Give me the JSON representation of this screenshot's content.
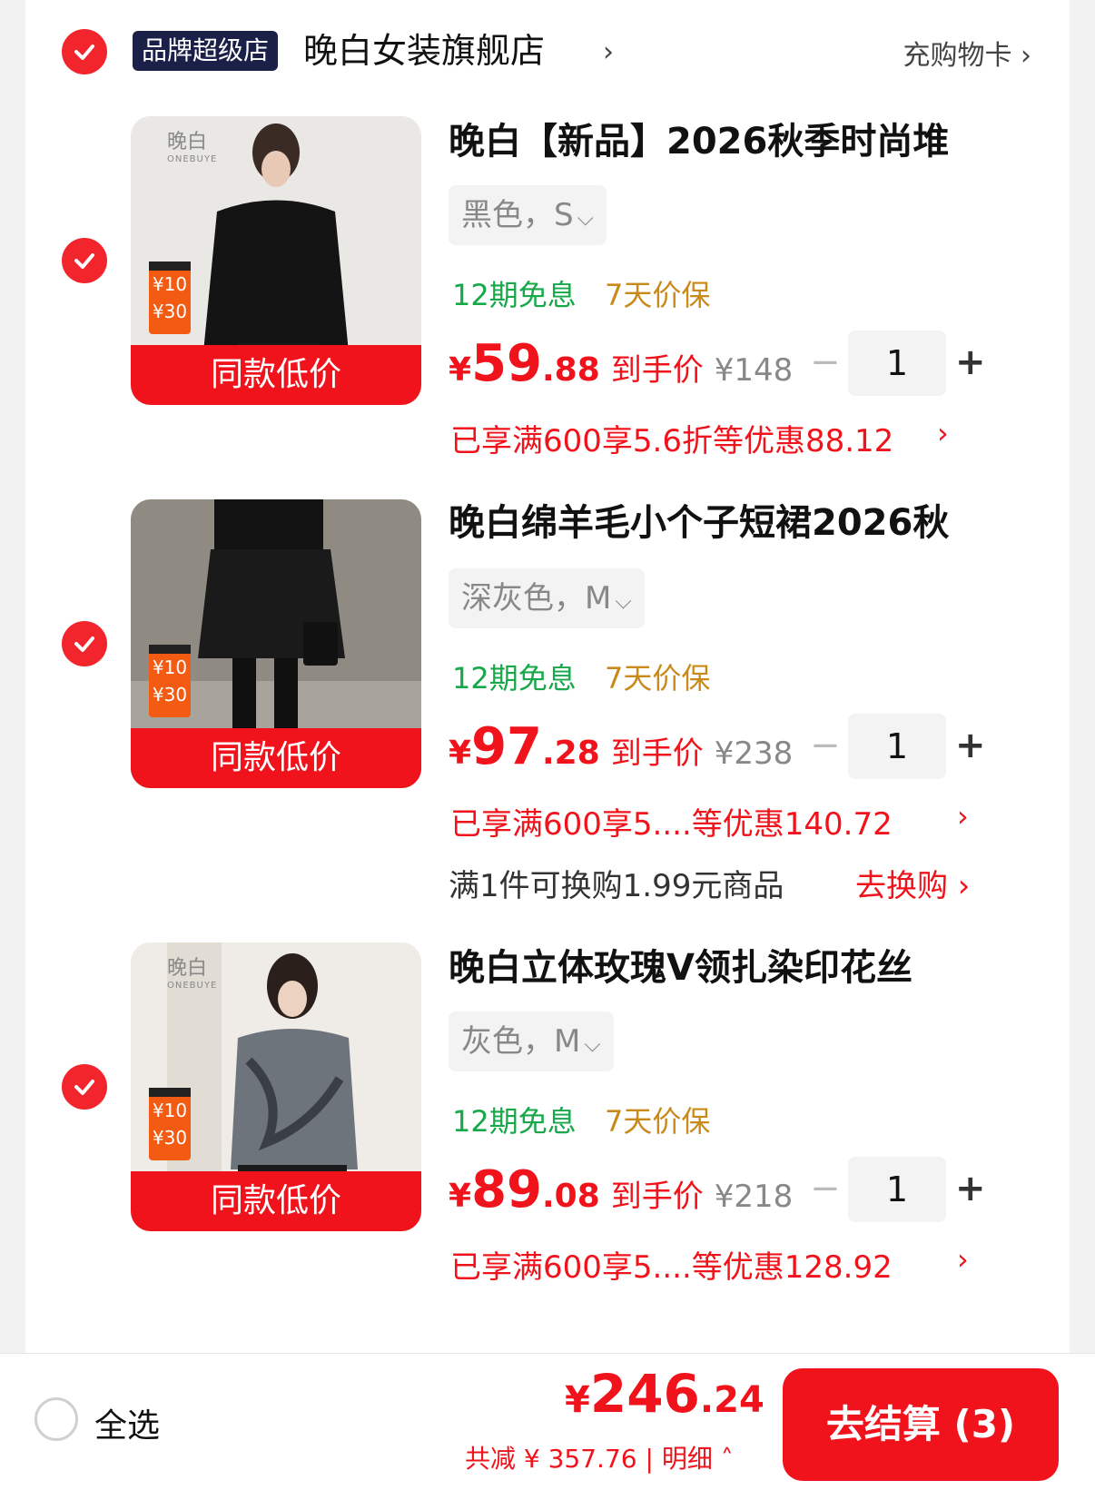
{
  "store": {
    "badge": "品牌超级店",
    "name": "晚白女装旗舰店",
    "name_chevron": "›",
    "card_link": "充购物卡 ›"
  },
  "items": [
    {
      "checked": true,
      "brand_logo": "晚白",
      "brand_logo_sub": "ONEBUYE",
      "coupon_top": "¥10",
      "coupon_bottom": "¥30",
      "low_price_label": "同款低价",
      "title": "晚白【新品】2026秋季时尚堆",
      "sku": "黑色，S",
      "tag_interest": "12期免息",
      "tag_protect": "7天价保",
      "price_currency": "¥",
      "price_int": "59",
      "price_dec": ".88",
      "price_label": "到手价",
      "original_price": "¥148",
      "qty": "1",
      "promo": "已享满600享5.6折等优惠88.12",
      "promo_chevron": "›"
    },
    {
      "checked": true,
      "brand_logo": "",
      "coupon_top": "¥10",
      "coupon_bottom": "¥30",
      "low_price_label": "同款低价",
      "title": "晚白绵羊毛小个子短裙2026秋",
      "sku": "深灰色，M",
      "tag_interest": "12期免息",
      "tag_protect": "7天价保",
      "price_currency": "¥",
      "price_int": "97",
      "price_dec": ".28",
      "price_label": "到手价",
      "original_price": "¥238",
      "qty": "1",
      "promo": "已享满600享5....等优惠140.72",
      "promo_chevron": "›",
      "swap_text": "满1件可换购1.99元商品",
      "swap_link": "去换购 ›"
    },
    {
      "checked": true,
      "brand_logo": "晚白",
      "brand_logo_sub": "ONEBUYE",
      "coupon_top": "¥10",
      "coupon_bottom": "¥30",
      "low_price_label": "同款低价",
      "title": "晚白立体玫瑰V领扎染印花丝",
      "sku": "灰色，M",
      "tag_interest": "12期免息",
      "tag_protect": "7天价保",
      "price_currency": "¥",
      "price_int": "89",
      "price_dec": ".08",
      "price_label": "到手价",
      "original_price": "¥218",
      "qty": "1",
      "promo": "已享满600享5....等优惠128.92",
      "promo_chevron": "›"
    }
  ],
  "qty_minus": "−",
  "qty_plus": "+",
  "sku_chevron": "⌵",
  "bottom": {
    "select_all": "全选",
    "total_currency": "¥",
    "total_int": "246",
    "total_dec": ".24",
    "saved": "共减 ¥ 357.76 | 明细 ˄",
    "checkout": "去结算 (3)"
  },
  "colors": {
    "accent_red": "#f0131c",
    "check_red": "#f2242c",
    "green": "#17a84a",
    "orange": "#c98a1a",
    "badge_navy": "#1b2048"
  }
}
